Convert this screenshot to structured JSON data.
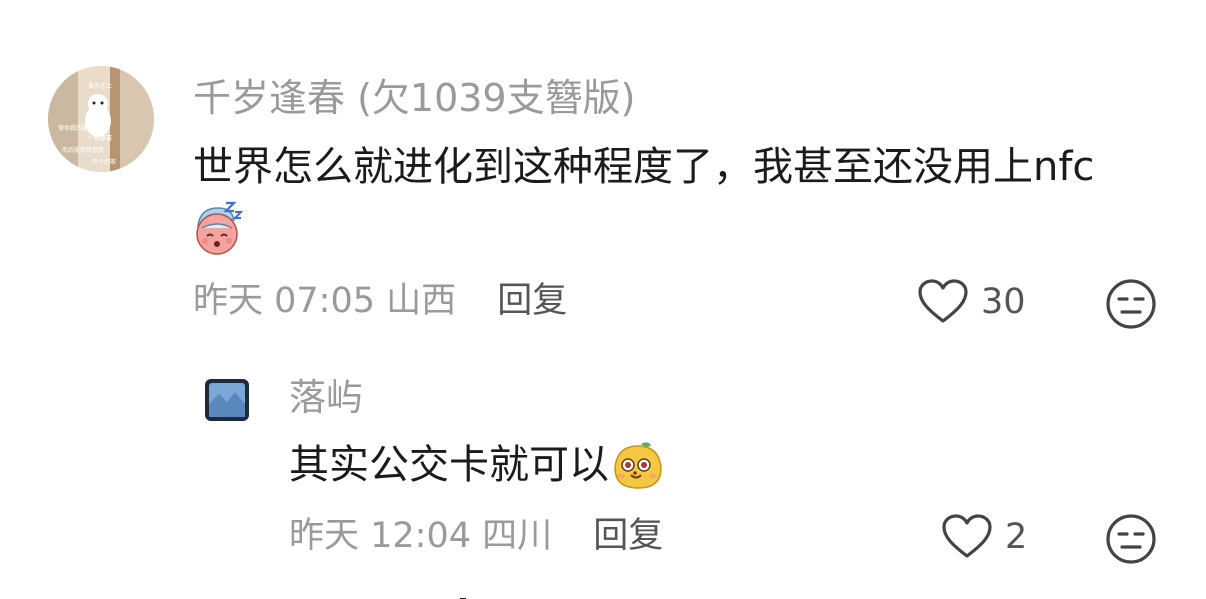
{
  "comment": {
    "username": "千岁逢春 (欠1039支簪版)",
    "text": "世界怎么就进化到这种程度了，我甚至还没用上nfc",
    "emoji_icon": "sleepy-face-emoji",
    "date": "昨天 07:05",
    "location": "山西",
    "reply_label": "回复",
    "likes": "30",
    "avatar_caption": [
      "黄天在上",
      "保佑我的朋友们",
      "一夜暴富",
      "而后能用我狠狠",
      "开个奶茶"
    ]
  },
  "reply": {
    "username": "落屿",
    "text": "其实公交卡就可以",
    "emoji_icon": "mango-face-emoji",
    "date": "昨天 12:04",
    "location": "四川",
    "reply_label": "回复",
    "likes": "2"
  },
  "icons": {
    "like": "heart-outline-icon",
    "dislike": "unamused-face-icon"
  },
  "colors": {
    "username": "#9a9a9a",
    "content": "#1b1b1b",
    "meta": "#9a9a9a",
    "reply_link": "#555555",
    "icon_stroke": "#444444"
  }
}
